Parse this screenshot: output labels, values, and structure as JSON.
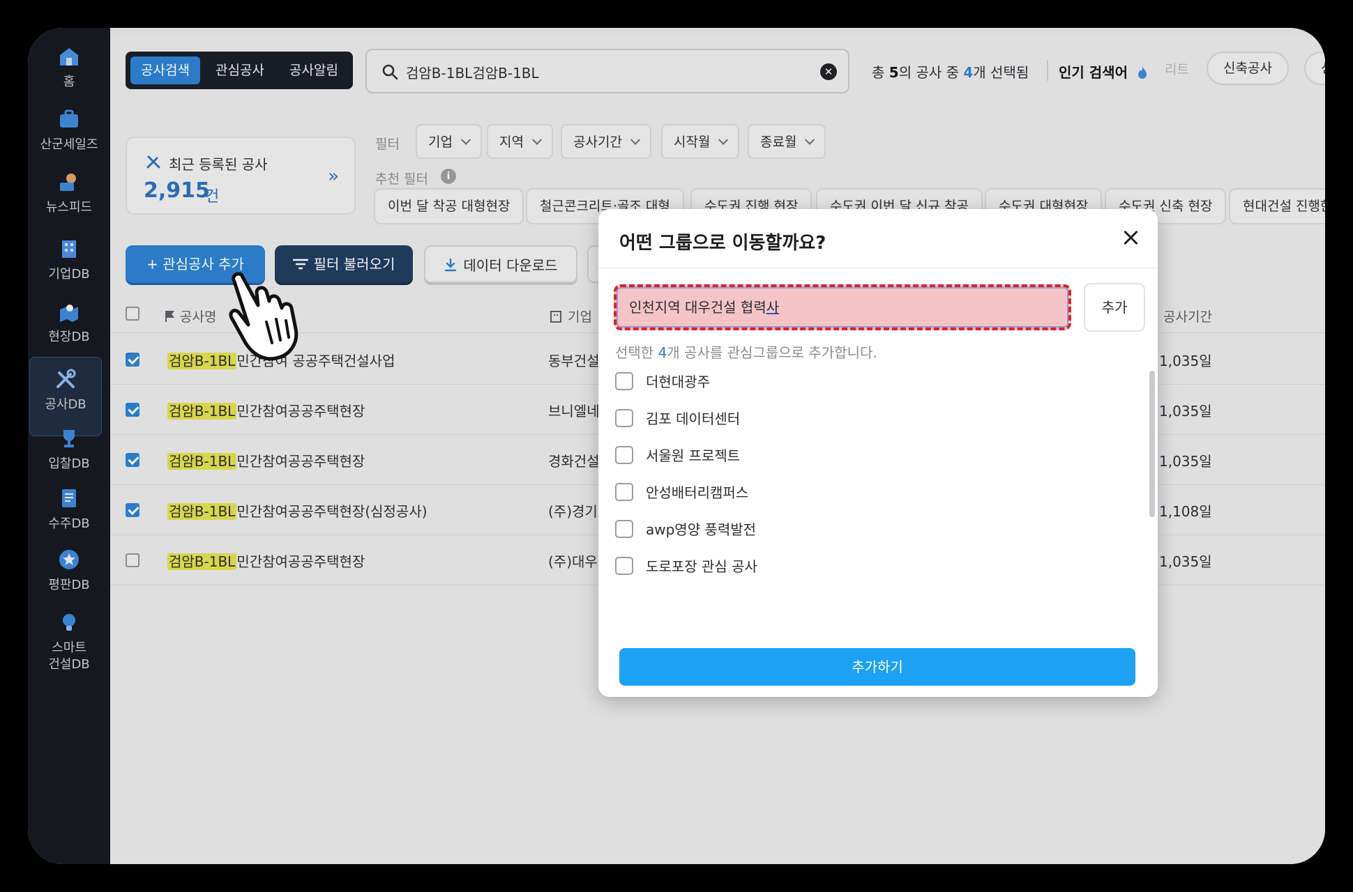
{
  "sidebar": {
    "items": [
      {
        "label": "홈",
        "icon": "home-icon"
      },
      {
        "label": "산군세일즈",
        "icon": "briefcase-icon"
      },
      {
        "label": "뉴스피드",
        "icon": "news-icon"
      },
      {
        "label": "기업DB",
        "icon": "building-icon"
      },
      {
        "label": "현장DB",
        "icon": "map-pin-icon"
      },
      {
        "label": "공사DB",
        "icon": "tools-icon",
        "active": true
      },
      {
        "label": "입찰DB",
        "icon": "trophy-icon"
      },
      {
        "label": "수주DB",
        "icon": "document-icon"
      },
      {
        "label": "평판DB",
        "icon": "star-badge-icon"
      },
      {
        "label": "스마트",
        "label2": "건설DB",
        "icon": "lightbulb-icon"
      }
    ]
  },
  "header": {
    "tabs": [
      {
        "label": "공사검색",
        "active": true
      },
      {
        "label": "관심공사"
      },
      {
        "label": "공사알림"
      }
    ],
    "search": {
      "value": "검암B-1BL검암B-1BL"
    },
    "summary": {
      "prefix": "총 ",
      "total": "5",
      "mid": "의 공사 중 ",
      "selected": "4",
      "suffix": "개 선택됨"
    },
    "popular": {
      "label": "인기 검색어",
      "faded": "리트",
      "chips": [
        "신축공사",
        "신축"
      ]
    }
  },
  "recent": {
    "title": "최근 등록된 공사",
    "count": "2,915",
    "unit": "건",
    "arrow": "»"
  },
  "filters": {
    "label": "필터",
    "chips": [
      "기업",
      "지역",
      "공사기간",
      "시작월",
      "종료월"
    ],
    "recommend_label": "추천 필터",
    "recommend": [
      "이번 달 착공 대형현장",
      "철근콘크리트·골조 대형",
      "수도권 진행 현장",
      "수도권 이번 달 신규 착공",
      "수도권 대형현장",
      "수도권 신축 현장",
      "현대건설 진행한"
    ]
  },
  "actions": {
    "add": "+ 관심공사 추가",
    "load": "필터 불러오기",
    "download": "데이터 다운로드"
  },
  "table": {
    "headers": {
      "name": "공사명",
      "corp": "기업",
      "duration": "공사기간"
    },
    "rows": [
      {
        "checked": true,
        "hl": "검암B-1BL",
        "rest": "민간참여 공공주택건설사업",
        "corp": "동부건설",
        "duration": "1,035일"
      },
      {
        "checked": true,
        "hl": "검암B-1BL",
        "rest": "민간참여공공주택현장",
        "corp": "브니엘네",
        "duration": "1,035일"
      },
      {
        "checked": true,
        "hl": "검암B-1BL",
        "rest": "민간참여공공주택현장",
        "corp": "경화건설",
        "duration": "1,035일"
      },
      {
        "checked": true,
        "hl": "검암B-1BL",
        "rest": "민간참여공공주택현장(심정공사)",
        "corp": "(주)경기",
        "duration": "1,108일"
      },
      {
        "checked": false,
        "hl": "검암B-1BL",
        "rest": "민간참여공공주택현장",
        "corp": "(주)대우",
        "duration": "1,035일"
      }
    ]
  },
  "modal": {
    "title": "어떤 그룹으로 이동할까요?",
    "input_value_main": "인천지역 대우건설 협력",
    "input_value_cursor": "사",
    "inline_add": "추가",
    "hint_prefix": "선택한 ",
    "hint_count": "4",
    "hint_suffix": "개 공사를 관심그룹으로 추가합니다.",
    "groups": [
      "더현대광주",
      "김포 데이터센터",
      "서울원 프로젝트",
      "안성배터리캠퍼스",
      "awp영양 풍력발전",
      "도로포장 관심 공사"
    ],
    "submit": "추가하기"
  },
  "colors": {
    "accent": "#2a7fd1",
    "submit": "#1da1f4",
    "highlight": "#e2e04a",
    "focus_dash": "#e0202a"
  }
}
